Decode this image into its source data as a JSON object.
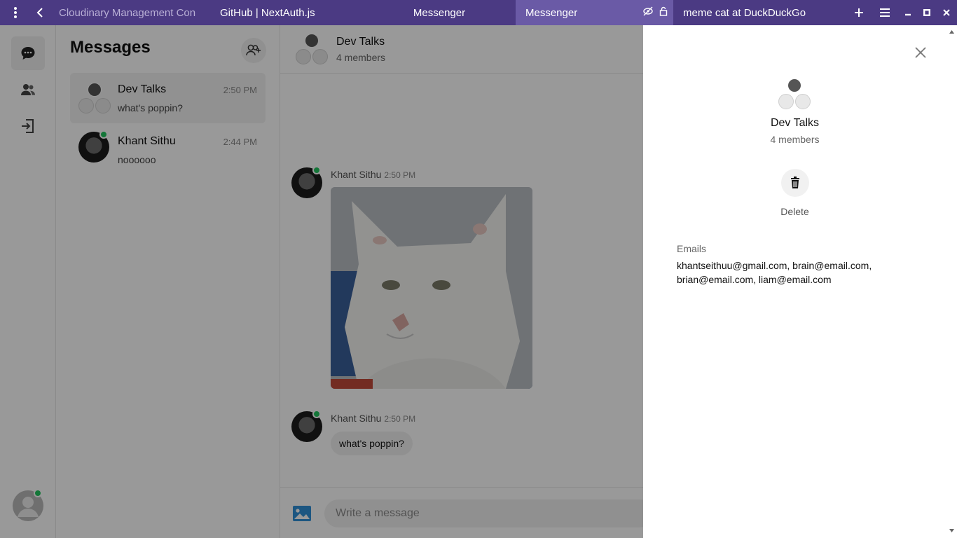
{
  "browser": {
    "tabs": [
      {
        "title": "Cloudinary Management Con",
        "state": "dim"
      },
      {
        "title": "GitHub | NextAuth.js",
        "state": "normal"
      },
      {
        "title": "Messenger",
        "state": "normal"
      },
      {
        "title": "Messenger",
        "state": "active"
      },
      {
        "title": "meme cat at DuckDuckGo",
        "state": "normal"
      }
    ]
  },
  "sidebar": {
    "title": "Messages",
    "conversations": [
      {
        "name": "Dev Talks",
        "time": "2:50 PM",
        "last_message": "what's poppin?",
        "type": "group"
      },
      {
        "name": "Khant Sithu",
        "time": "2:44 PM",
        "last_message": "noooooo",
        "type": "user",
        "online": true
      }
    ]
  },
  "chat": {
    "title": "Dev Talks",
    "subtitle": "4 members",
    "messages": [
      {
        "sender": "Khant Sithu",
        "time": "2:50 PM",
        "kind": "image"
      },
      {
        "sender": "Khant Sithu",
        "time": "2:50 PM",
        "kind": "text",
        "text": "what's poppin?"
      }
    ],
    "composer_placeholder": "Write a message"
  },
  "drawer": {
    "title": "Dev Talks",
    "subtitle": "4 members",
    "delete_label": "Delete",
    "emails_label": "Emails",
    "emails": "khantseithuu@gmail.com, brain@email.com, brian@email.com, liam@email.com"
  },
  "colors": {
    "tabbar": "#4b3a83",
    "active_tab": "#6a5aa6",
    "online": "#22c55e",
    "image_icon": "#2f8fd8"
  }
}
